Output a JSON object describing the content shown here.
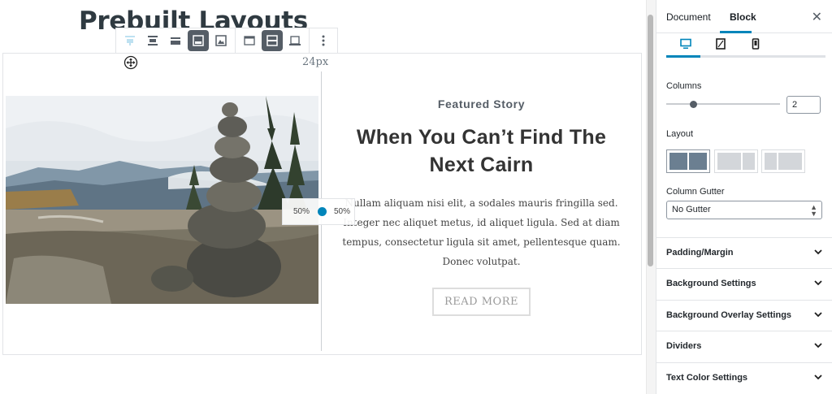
{
  "page": {
    "title": "Prebuilt Layouts"
  },
  "toolbar": {
    "spacing_label": "24px",
    "buttons": [
      {
        "name": "align-top-icon"
      },
      {
        "name": "align-center-icon"
      },
      {
        "name": "align-bottom-icon"
      },
      {
        "name": "full-height-icon"
      },
      {
        "name": "image-background-icon"
      },
      {
        "name": "wide-width-icon"
      },
      {
        "name": "full-width-icon"
      },
      {
        "name": "inner-layout-icon"
      },
      {
        "name": "more-options-icon"
      }
    ]
  },
  "section": {
    "resize": {
      "left_label": "50%",
      "right_label": "50%"
    },
    "story": {
      "eyebrow": "Featured Story",
      "headline": "When You Can’t Find The Next Cairn",
      "body": "Nullam aliquam nisi elit, a sodales mauris fringilla sed. Integer nec aliquet metus, id aliquet ligula. Sed at diam tempus, consectetur ligula sit amet, pellentesque quam. Donec volutpat.",
      "button_label": "READ MORE"
    }
  },
  "sidebar": {
    "tabs": {
      "document": "Document",
      "block": "Block"
    },
    "close_icon": "close-icon",
    "devices": [
      "desktop-icon",
      "tablet-icon",
      "mobile-icon"
    ],
    "columns": {
      "label": "Columns",
      "value": "2"
    },
    "layout": {
      "label": "Layout",
      "selected_index": 0
    },
    "gutter": {
      "label": "Column Gutter",
      "value": "No Gutter"
    },
    "panels": [
      "Padding/Margin",
      "Background Settings",
      "Background Overlay Settings",
      "Dividers",
      "Text Color Settings"
    ]
  },
  "colors": {
    "accent": "#0085ba",
    "toolbar_active": "#555d66"
  }
}
